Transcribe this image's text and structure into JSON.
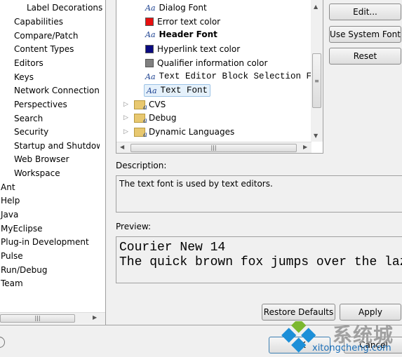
{
  "sidebar": {
    "items": [
      "Label Decorations",
      "Capabilities",
      "Compare/Patch",
      "Content Types",
      "Editors",
      "Keys",
      "Network Connections",
      "Perspectives",
      "Search",
      "Security",
      "Startup and Shutdown",
      "Web Browser",
      "Workspace",
      "Ant",
      "Help",
      "Java",
      "MyEclipse",
      "Plug-in Development",
      "Pulse",
      "Run/Debug",
      "Team"
    ]
  },
  "tree": {
    "items": [
      {
        "label": "Dialog Font",
        "icon": "font-icon"
      },
      {
        "label": "Error text color",
        "icon": "color-swatch",
        "color": "#e81010"
      },
      {
        "label": "Header Font",
        "icon": "font-icon"
      },
      {
        "label": "Hyperlink text color",
        "icon": "color-swatch",
        "color": "#0a0a80"
      },
      {
        "label": "Qualifier information color",
        "icon": "color-swatch",
        "color": "#808080"
      },
      {
        "label": "Text Editor Block Selection Font",
        "icon": "font-icon"
      },
      {
        "label": "Text Font",
        "icon": "font-icon",
        "selected": true
      },
      {
        "label": "CVS",
        "icon": "folder-icon"
      },
      {
        "label": "Debug",
        "icon": "folder-icon"
      },
      {
        "label": "Dynamic Languages",
        "icon": "folder-icon"
      }
    ]
  },
  "buttons": {
    "edit": "Edit...",
    "use_system_font": "Use System Font",
    "reset": "Reset",
    "restore_defaults": "Restore Defaults",
    "apply": "Apply",
    "ok": "OK",
    "cancel": "Cancel"
  },
  "description": {
    "label": "Description:",
    "text": "The text font is used by text editors."
  },
  "preview": {
    "label": "Preview:",
    "line1": "Courier New 14",
    "line2": "The quick brown fox jumps over the lazy dog."
  },
  "watermark": {
    "text": "系统城",
    "url_text": "xitongcheng.com"
  }
}
